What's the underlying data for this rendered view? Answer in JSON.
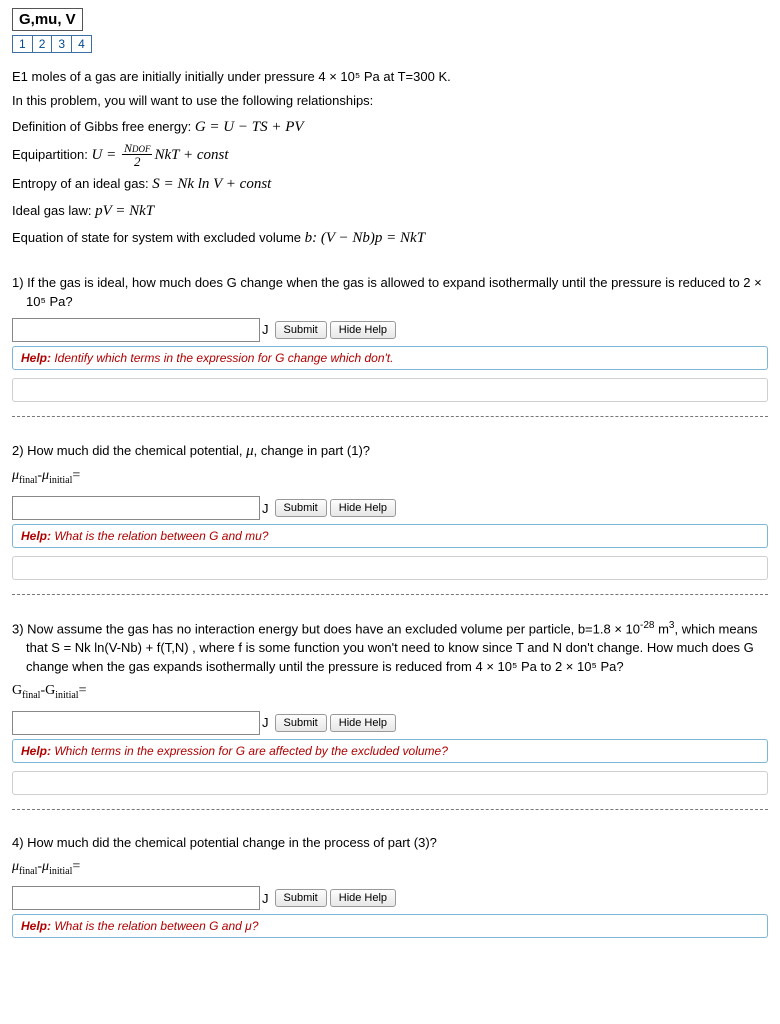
{
  "header": {
    "title": "G,mu, V",
    "tabs": [
      "1",
      "2",
      "3",
      "4"
    ]
  },
  "intro": {
    "line1": "E1 moles of a gas are initially initially under pressure 4 × 10⁵ Pa at T=300 K.",
    "line2": "In this problem, you will want to use the following relationships:",
    "gibbs_label": "Definition of Gibbs free energy: ",
    "gibbs_eq": "G = U − TS + PV",
    "equi_label": "Equipartition: ",
    "equi_eq_tail": "NkT + const",
    "entropy_label": "Entropy of an ideal gas: ",
    "entropy_eq": "S = Nk ln V + const",
    "ideal_label": "Ideal gas law: ",
    "ideal_eq": "pV = NkT",
    "eos_label": "Equation of state for system with excluded volume ",
    "eos_b": "b",
    "eos_eq": ": (V − Nb)p = NkT"
  },
  "q1": {
    "text": "1) If the gas is ideal, how much does G change when the gas is allowed to expand isothermally until the pressure is reduced to 2 × 10⁵ Pa?",
    "unit": "J",
    "submit": "Submit",
    "hide": "Hide Help",
    "help_label": "Help: ",
    "help_text": "Identify which terms in the expression for G change which don't."
  },
  "q2": {
    "text_a": "2) How much did the chemical potential, ",
    "mu": "μ",
    "text_b": ", change in part (1)?",
    "eq_label": "μfinal-μinitial=",
    "unit": "J",
    "submit": "Submit",
    "hide": "Hide Help",
    "help_label": "Help: ",
    "help_text": "What is the relation between G and mu?"
  },
  "q3": {
    "text_a": "3) Now assume the gas has no interaction energy but does have an excluded volume per particle, b=1.8 × 10",
    "text_b": " m",
    "text_c": ", which means that S = Nk ln(V-Nb) + f(T,N) , where  f  is some function you won't need to know since T and N don't change. How much does G change when the gas expands isothermally until the pressure is reduced from 4 × 10⁵ Pa to 2 × 10⁵  Pa?",
    "eq_label": "Gfinal-Ginitial=",
    "unit": "J",
    "submit": "Submit",
    "hide": "Hide Help",
    "help_label": "Help: ",
    "help_text": "Which terms in the expression for G are affected by the excluded volume?"
  },
  "q4": {
    "text": "4) How much did the chemical potential change in the process of part (3)?",
    "eq_label": "μfinal-μinitial=",
    "unit": "J",
    "submit": "Submit",
    "hide": "Hide Help",
    "help_label": "Help: ",
    "help_text": "What is the relation between G and μ?"
  }
}
